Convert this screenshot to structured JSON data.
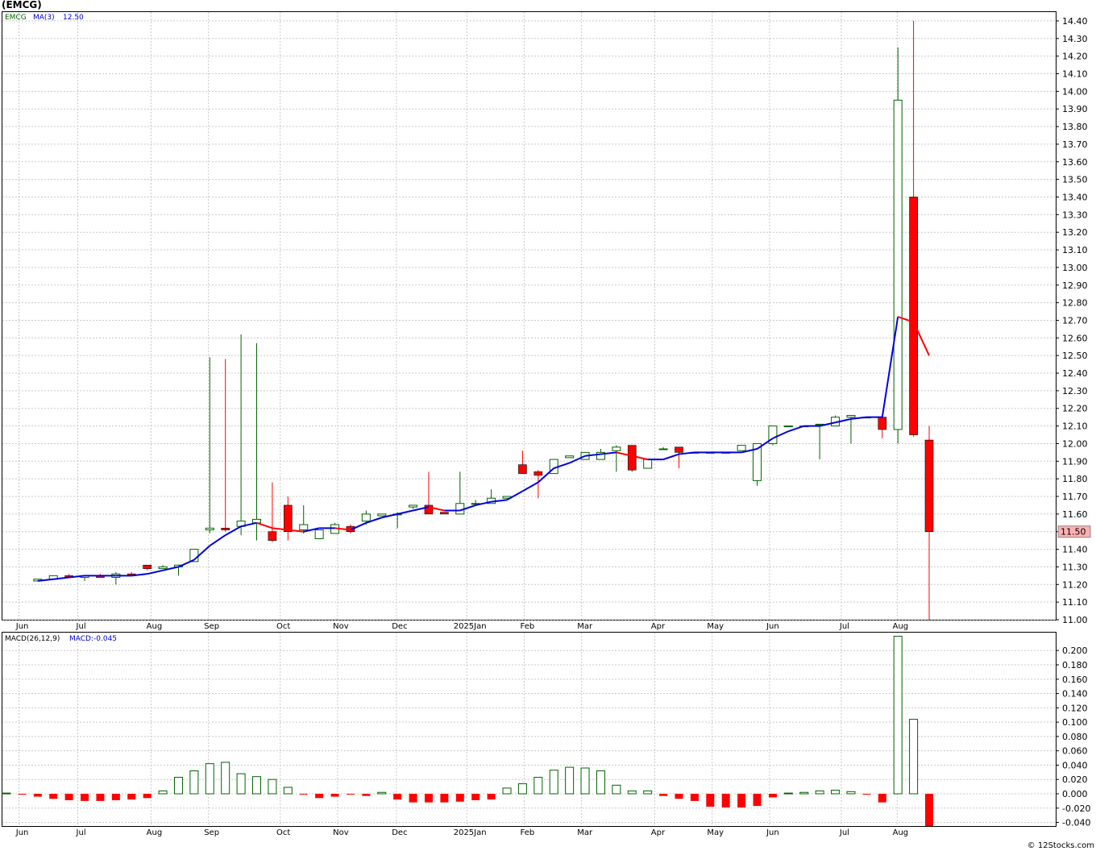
{
  "title": "(EMCG)",
  "credit": "© 12Stocks.com",
  "colors": {
    "up": "#006400",
    "down": "#ff0000",
    "ma_rise": "#0000dd",
    "ma_fall": "#ff0000",
    "grid": "#c8c8c8",
    "price_box": "#ffb0b0"
  },
  "chart_data": [
    {
      "type": "candlestick",
      "legend": {
        "symbol": "EMCG",
        "ma_label": "MA(3)",
        "ma_value": "12.50"
      },
      "last_price_label": "11.50",
      "ylim": [
        11.0,
        14.45
      ],
      "yticks": [
        "11.00",
        "11.10",
        "11.20",
        "11.30",
        "11.40",
        "11.50",
        "11.60",
        "11.70",
        "11.80",
        "11.90",
        "12.00",
        "12.10",
        "12.20",
        "12.30",
        "12.40",
        "12.50",
        "12.60",
        "12.70",
        "12.80",
        "12.90",
        "13.00",
        "13.10",
        "13.20",
        "13.30",
        "13.40",
        "13.50",
        "13.60",
        "13.70",
        "13.80",
        "13.90",
        "14.00",
        "14.10",
        "14.20",
        "14.30",
        "14.40"
      ],
      "month_labels": [
        "Jun",
        "Jul",
        "Aug",
        "Sep",
        "Oct",
        "Nov",
        "Dec",
        "2025Jan",
        "Feb",
        "Mar",
        "Apr",
        "May",
        "Jun",
        "Jul",
        "Aug"
      ],
      "grid": true,
      "ohlc": [
        [
          11.22,
          11.23,
          11.22,
          11.23
        ],
        [
          11.23,
          11.25,
          11.23,
          11.25
        ],
        [
          11.25,
          11.26,
          11.24,
          11.24
        ],
        [
          11.24,
          11.25,
          11.22,
          11.25
        ],
        [
          11.25,
          11.26,
          11.24,
          11.24
        ],
        [
          11.24,
          11.27,
          11.2,
          11.26
        ],
        [
          11.26,
          11.27,
          11.25,
          11.25
        ],
        [
          11.31,
          11.31,
          11.28,
          11.29
        ],
        [
          11.29,
          11.31,
          11.29,
          11.3
        ],
        [
          11.3,
          11.31,
          11.25,
          11.31
        ],
        [
          11.33,
          11.34,
          11.33,
          11.4
        ],
        [
          11.51,
          12.49,
          11.49,
          11.52
        ],
        [
          11.52,
          12.48,
          11.5,
          11.51
        ],
        [
          11.53,
          12.62,
          11.48,
          11.56
        ],
        [
          11.55,
          12.57,
          11.45,
          11.57
        ],
        [
          11.5,
          11.78,
          11.44,
          11.45
        ],
        [
          11.65,
          11.7,
          11.45,
          11.5
        ],
        [
          11.51,
          11.65,
          11.49,
          11.54
        ],
        [
          11.46,
          11.51,
          11.46,
          11.51
        ],
        [
          11.49,
          11.55,
          11.49,
          11.54
        ],
        [
          11.53,
          11.54,
          11.49,
          11.5
        ],
        [
          11.56,
          11.62,
          11.54,
          11.6
        ],
        [
          11.59,
          11.6,
          11.59,
          11.6
        ],
        [
          11.6,
          11.61,
          11.52,
          11.6
        ],
        [
          11.64,
          11.65,
          11.63,
          11.65
        ],
        [
          11.65,
          11.84,
          11.6,
          11.6
        ],
        [
          11.61,
          11.61,
          11.6,
          11.6
        ],
        [
          11.6,
          11.84,
          11.6,
          11.66
        ],
        [
          11.66,
          11.68,
          11.66,
          11.66
        ],
        [
          11.66,
          11.74,
          11.66,
          11.69
        ],
        [
          11.69,
          11.7,
          11.69,
          11.7
        ],
        [
          11.88,
          11.96,
          11.83,
          11.83
        ],
        [
          11.84,
          11.85,
          11.69,
          11.82
        ],
        [
          11.83,
          11.9,
          11.83,
          11.91
        ],
        [
          11.92,
          11.93,
          11.92,
          11.93
        ],
        [
          11.91,
          11.95,
          11.91,
          11.95
        ],
        [
          11.91,
          11.97,
          11.91,
          11.95
        ],
        [
          11.96,
          11.99,
          11.84,
          11.98
        ],
        [
          11.99,
          11.99,
          11.84,
          11.85
        ],
        [
          11.86,
          11.9,
          11.86,
          11.91
        ],
        [
          11.97,
          11.98,
          11.97,
          11.97
        ],
        [
          11.98,
          11.98,
          11.86,
          11.95
        ],
        [
          11.95,
          11.95,
          11.95,
          11.95
        ],
        [
          11.95,
          11.95,
          11.95,
          11.95
        ],
        [
          11.95,
          11.95,
          11.95,
          11.95
        ],
        [
          11.96,
          11.99,
          11.96,
          11.99
        ],
        [
          11.79,
          12.0,
          11.76,
          12.0
        ],
        [
          12.0,
          12.1,
          11.99,
          12.1
        ],
        [
          12.1,
          12.1,
          12.1,
          12.1
        ],
        [
          12.1,
          12.1,
          12.1,
          12.1
        ],
        [
          12.11,
          12.11,
          11.91,
          12.11
        ],
        [
          12.1,
          12.16,
          12.1,
          12.15
        ],
        [
          12.15,
          12.16,
          12.0,
          12.16
        ],
        [
          12.15,
          12.15,
          12.15,
          12.15
        ],
        [
          12.15,
          12.16,
          12.03,
          12.08
        ],
        [
          12.08,
          14.25,
          12.0,
          13.95
        ],
        [
          13.4,
          14.4,
          12.04,
          12.05
        ],
        [
          12.02,
          12.1,
          11.0,
          11.5
        ]
      ],
      "ma": [
        11.22,
        11.23,
        11.24,
        11.25,
        11.25,
        11.25,
        11.25,
        11.26,
        11.28,
        11.3,
        11.34,
        11.42,
        11.48,
        11.53,
        11.55,
        11.52,
        11.51,
        11.5,
        11.52,
        11.52,
        11.51,
        11.55,
        11.58,
        11.6,
        11.62,
        11.64,
        11.62,
        11.62,
        11.65,
        11.67,
        11.68,
        11.73,
        11.78,
        11.86,
        11.89,
        11.93,
        11.94,
        11.95,
        11.93,
        11.91,
        11.91,
        11.94,
        11.95,
        11.95,
        11.95,
        11.95,
        11.97,
        12.03,
        12.07,
        12.1,
        12.1,
        12.12,
        12.14,
        12.15,
        12.15,
        12.72,
        12.69,
        12.5
      ]
    },
    {
      "type": "bar",
      "legend": {
        "label": "MACD(26,12,9)",
        "value_label": "MACD:-0.045"
      },
      "ylim": [
        -0.045,
        0.225
      ],
      "yticks": [
        "-0.040",
        "-0.020",
        "0.000",
        "0.020",
        "0.040",
        "0.060",
        "0.080",
        "0.100",
        "0.120",
        "0.140",
        "0.160",
        "0.180",
        "0.200"
      ],
      "month_labels": [
        "Jun",
        "Jul",
        "Aug",
        "Sep",
        "Oct",
        "Nov",
        "Dec",
        "2025Jan",
        "Feb",
        "Mar",
        "Apr",
        "May",
        "Jun",
        "Jul",
        "Aug"
      ],
      "grid": true,
      "values": [
        0.001,
        -0.001,
        -0.004,
        -0.007,
        -0.009,
        -0.01,
        -0.01,
        -0.009,
        -0.008,
        -0.006,
        0.004,
        0.023,
        0.032,
        0.042,
        0.044,
        0.028,
        0.024,
        0.02,
        0.009,
        -0.001,
        -0.006,
        -0.004,
        -0.001,
        -0.003,
        0.002,
        -0.008,
        -0.012,
        -0.012,
        -0.012,
        -0.011,
        -0.009,
        -0.008,
        0.008,
        0.014,
        0.023,
        0.033,
        0.037,
        0.036,
        0.032,
        0.012,
        0.004,
        0.004,
        -0.003,
        -0.007,
        -0.01,
        -0.018,
        -0.019,
        -0.019,
        -0.017,
        -0.005,
        0.001,
        0.002,
        0.004,
        0.005,
        0.003,
        -0.001,
        -0.012,
        0.22,
        0.104,
        -0.045
      ]
    }
  ]
}
